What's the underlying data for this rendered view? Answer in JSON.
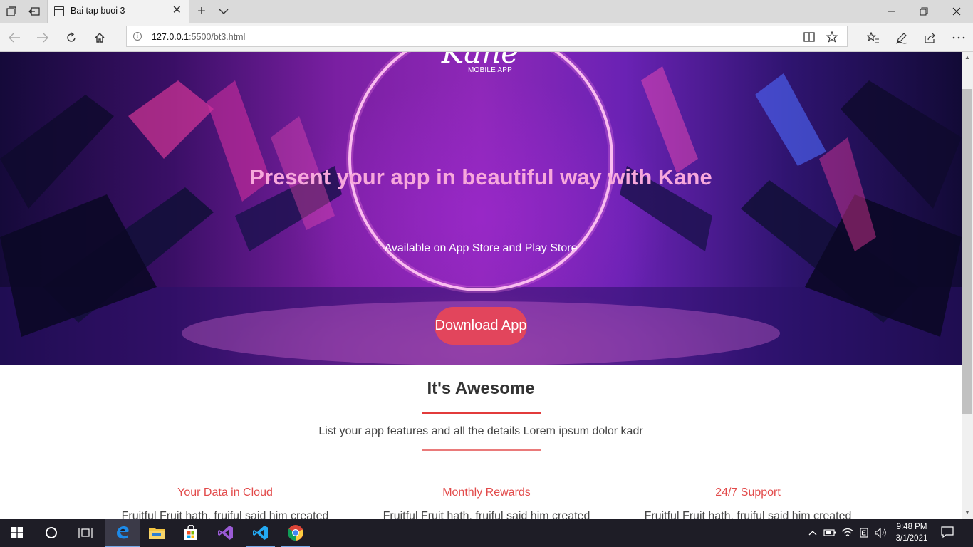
{
  "browser": {
    "tab_title": "Bai tap buoi 3",
    "url_host": "127.0.0.1",
    "url_path": ":5500/bt3.html",
    "icons": [
      "tab-manager-icon",
      "tab-set-aside-icon",
      "page-icon",
      "close-icon",
      "plus-icon",
      "chevron-down-icon",
      "minimize-icon",
      "restore-icon",
      "back-icon",
      "forward-icon",
      "refresh-icon",
      "home-icon",
      "info-icon",
      "reading-view-icon",
      "star-icon",
      "favorites-icon",
      "pen-icon",
      "share-icon",
      "more-icon"
    ]
  },
  "hero": {
    "logo_text": "Kane",
    "logo_subtext": "MOBILE APP",
    "title": "Present your app in beautiful way with Kane",
    "subtitle": "Available on App Store and Play Store",
    "download_label": "Download App"
  },
  "section": {
    "title": "It's Awesome",
    "subtitle": "List your app features and all the details Lorem ipsum dolor kadr"
  },
  "features": [
    {
      "title": "Your Data in Cloud",
      "text": "Fruitful Fruit hath, fruiful said him created"
    },
    {
      "title": "Monthly Rewards",
      "text": "Fruitful Fruit hath, fruiful said him created"
    },
    {
      "title": "24/7 Support",
      "text": "Fruitful Fruit hath, fruiful said him created"
    }
  ],
  "taskbar": {
    "time": "9:48 PM",
    "date": "3/1/2021",
    "apps": [
      "start",
      "cortana",
      "task-view",
      "edge",
      "file-explorer",
      "store",
      "visual-studio",
      "vs-code",
      "chrome"
    ]
  },
  "colors": {
    "accent_red": "#e24a4a",
    "button": "#e2455c",
    "hero_title": "#f7a8dc",
    "taskbar": "#1e1d26"
  }
}
